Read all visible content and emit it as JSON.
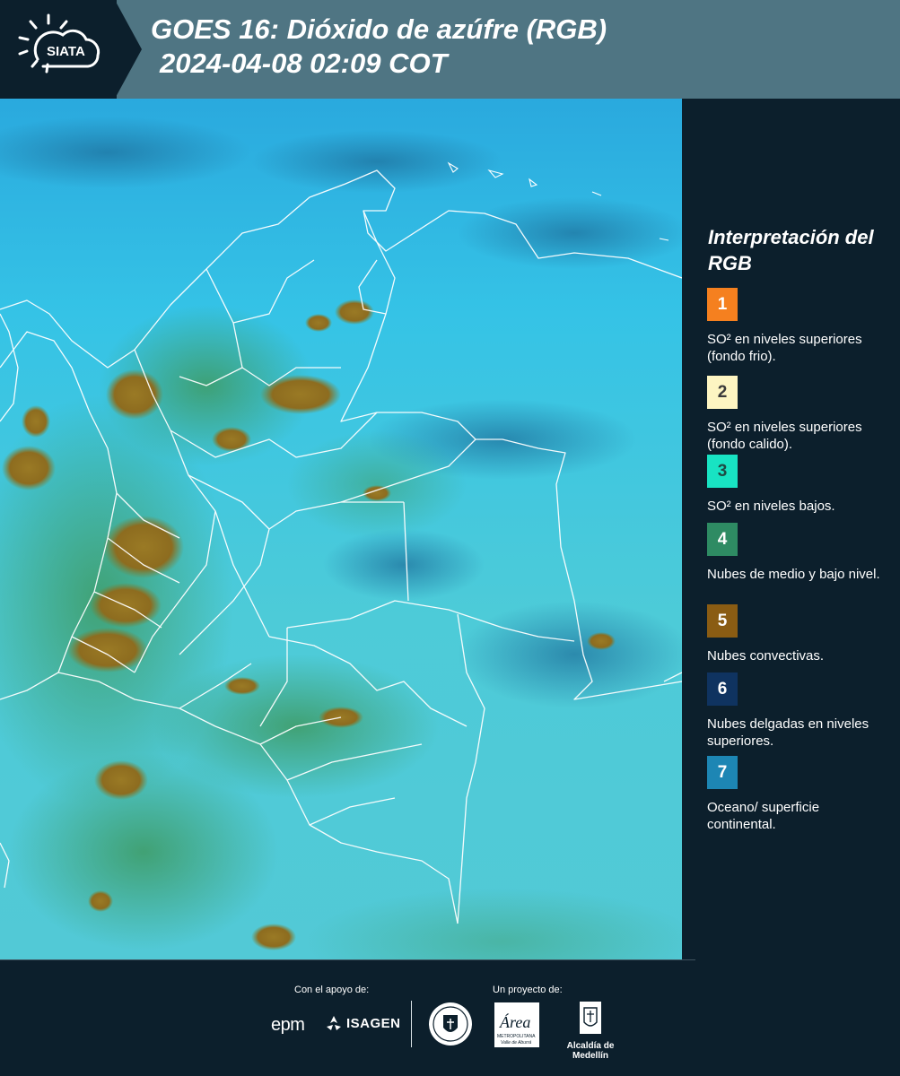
{
  "header": {
    "logo_text": "SIATA",
    "title": "GOES 16: Dióxido de azúfre (RGB)",
    "subtitle": "2024-04-08 02:09 COT"
  },
  "legend": {
    "title": "Interpretación del RGB",
    "items": [
      {
        "number": "1",
        "color": "#f5801f",
        "text_color": "#ffffff",
        "description": "SO² en niveles superiores (fondo frio)."
      },
      {
        "number": "2",
        "color": "#fdf5c2",
        "text_color": "#3a3a3a",
        "description": "SO² en niveles superiores (fondo calido)."
      },
      {
        "number": "3",
        "color": "#18e3c3",
        "text_color": "#1f4a44",
        "description": "SO² en niveles bajos."
      },
      {
        "number": "4",
        "color": "#2e8b63",
        "text_color": "#ffffff",
        "description": "Nubes de medio y bajo nivel."
      },
      {
        "number": "5",
        "color": "#8a5c13",
        "text_color": "#ffffff",
        "description": "Nubes convectivas."
      },
      {
        "number": "6",
        "color": "#0f3360",
        "text_color": "#ffffff",
        "description": "Nubes delgadas en niveles superiores."
      },
      {
        "number": "7",
        "color": "#1d86b4",
        "text_color": "#ffffff",
        "description": "Oceano/ superficie continental."
      }
    ]
  },
  "footer": {
    "support_label": "Con el apoyo de:",
    "project_label": "Un proyecto de:",
    "sponsors": [
      "epm",
      "ISAGEN"
    ],
    "partners": [
      "Área Metropolitana Valle de Aburrá",
      "Alcaldía de Medellín"
    ],
    "partner_logo_text": {
      "area": "Área",
      "area_sub1": "METROPOLITANA",
      "area_sub2": "Valle de Aburrá",
      "alcaldia": "Alcaldía de Medellín"
    }
  },
  "colors": {
    "background": "#0c1f2c",
    "header_band": "#4f7583",
    "map_sky": "#2fb6d6",
    "map_land": "#3ec3c4",
    "convective": "#8a6a20",
    "mid_low_cloud": "#2f8f5c"
  }
}
